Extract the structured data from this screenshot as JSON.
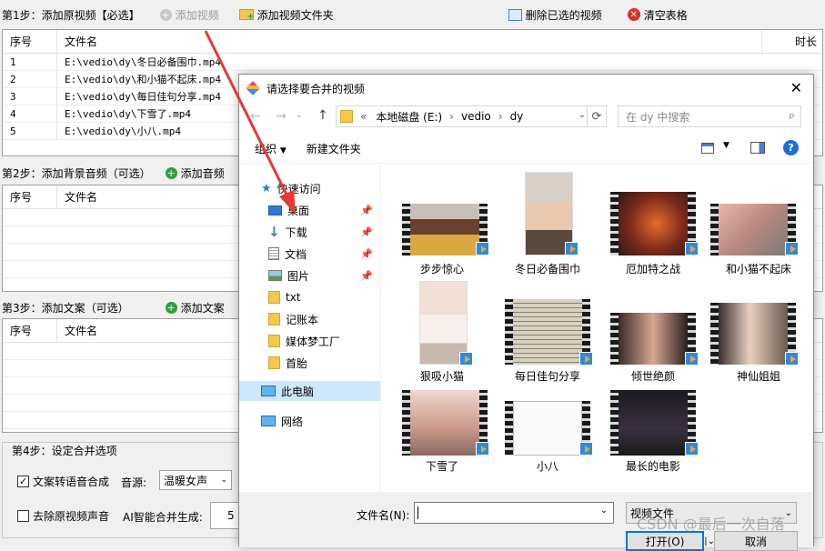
{
  "step1": {
    "label": "第1步：添加原视频【必选】",
    "add_video": "添加视频",
    "add_folder": "添加视频文件夹",
    "delete_selected": "删除已选的视频",
    "clear_table": "清空表格"
  },
  "table1": {
    "col_index": "序号",
    "col_filename": "文件名",
    "col_duration": "时长",
    "rows": [
      {
        "index": "1",
        "filename": "E:\\vedio\\dy\\冬日必备围巾.mp4"
      },
      {
        "index": "2",
        "filename": "E:\\vedio\\dy\\和小猫不起床.mp4"
      },
      {
        "index": "3",
        "filename": "E:\\vedio\\dy\\每日佳句分享.mp4"
      },
      {
        "index": "4",
        "filename": "E:\\vedio\\dy\\下雪了.mp4"
      },
      {
        "index": "5",
        "filename": "E:\\vedio\\dy\\小八.mp4"
      }
    ]
  },
  "step2": {
    "label": "第2步：添加背景音频（可选）",
    "add_audio": "添加音频"
  },
  "table2": {
    "col_index": "序号",
    "col_filename": "文件名"
  },
  "step3": {
    "label": "第3步：添加文案（可选）",
    "add_text": "添加文案"
  },
  "table3": {
    "col_index": "序号",
    "col_filename": "文件名"
  },
  "step4": {
    "label": "第4步：设定合并选项",
    "tts_label": "文案转语音合成",
    "tts_checked": true,
    "voice_label": "音源:",
    "voice_value": "温暖女声",
    "remove_audio_label": "去除原视频声音",
    "remove_audio_checked": false,
    "ai_label": "AI智能合并生成:",
    "ai_value": "5"
  },
  "dialog": {
    "title": "请选择要合并的视频",
    "breadcrumb": [
      "«",
      "本地磁盘 (E:)",
      "vedio",
      "dy"
    ],
    "search_placeholder": "在 dy 中搜索",
    "organize": "组织",
    "new_folder": "新建文件夹",
    "nav": {
      "quick_access": "快速访问",
      "items": [
        "桌面",
        "下载",
        "文档",
        "图片",
        "txt",
        "记账本",
        "媒体梦工厂",
        "首胎"
      ],
      "this_pc": "此电脑",
      "network": "网络"
    },
    "files": [
      "步步惊心",
      "冬日必备围巾",
      "厄加特之战",
      "和小猫不起床",
      "狠吸小猫",
      "每日佳句分享",
      "倾世绝颜",
      "神仙姐姐",
      "下雪了",
      "小八",
      "最长的电影"
    ],
    "filename_label": "文件名(N):",
    "filename_value": "",
    "filetype": "视频文件",
    "open_button": "打开(O)",
    "cancel_button": "取消"
  },
  "watermark": "CSDN @最后一次自落",
  "colors": {
    "play_blue": "#2a8be0",
    "arrow_red": "#e53935",
    "selected_nav": "#cce8ff",
    "help_blue": "#1f6fd0"
  }
}
